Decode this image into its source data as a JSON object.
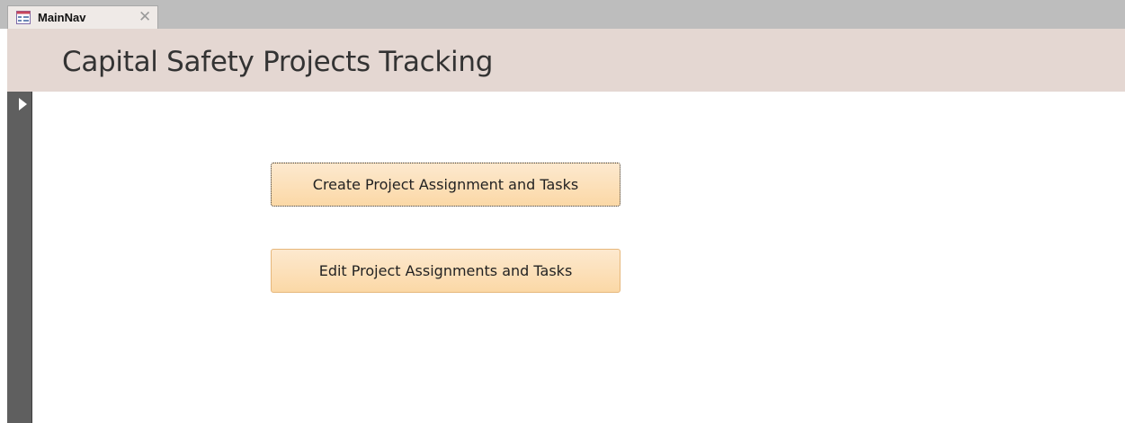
{
  "tab": {
    "label": "MainNav",
    "icon": "form-icon",
    "close_icon": "close-icon"
  },
  "header": {
    "title": "Capital Safety Projects Tracking"
  },
  "buttons": {
    "create": "Create Project Assignment and Tasks",
    "edit": "Edit Project Assignments and Tasks"
  },
  "colors": {
    "title_band": "#e4d7d2",
    "button_fill": "#fbd8a6",
    "button_border": "#e6b77b",
    "gutter": "#5f5f5f"
  }
}
